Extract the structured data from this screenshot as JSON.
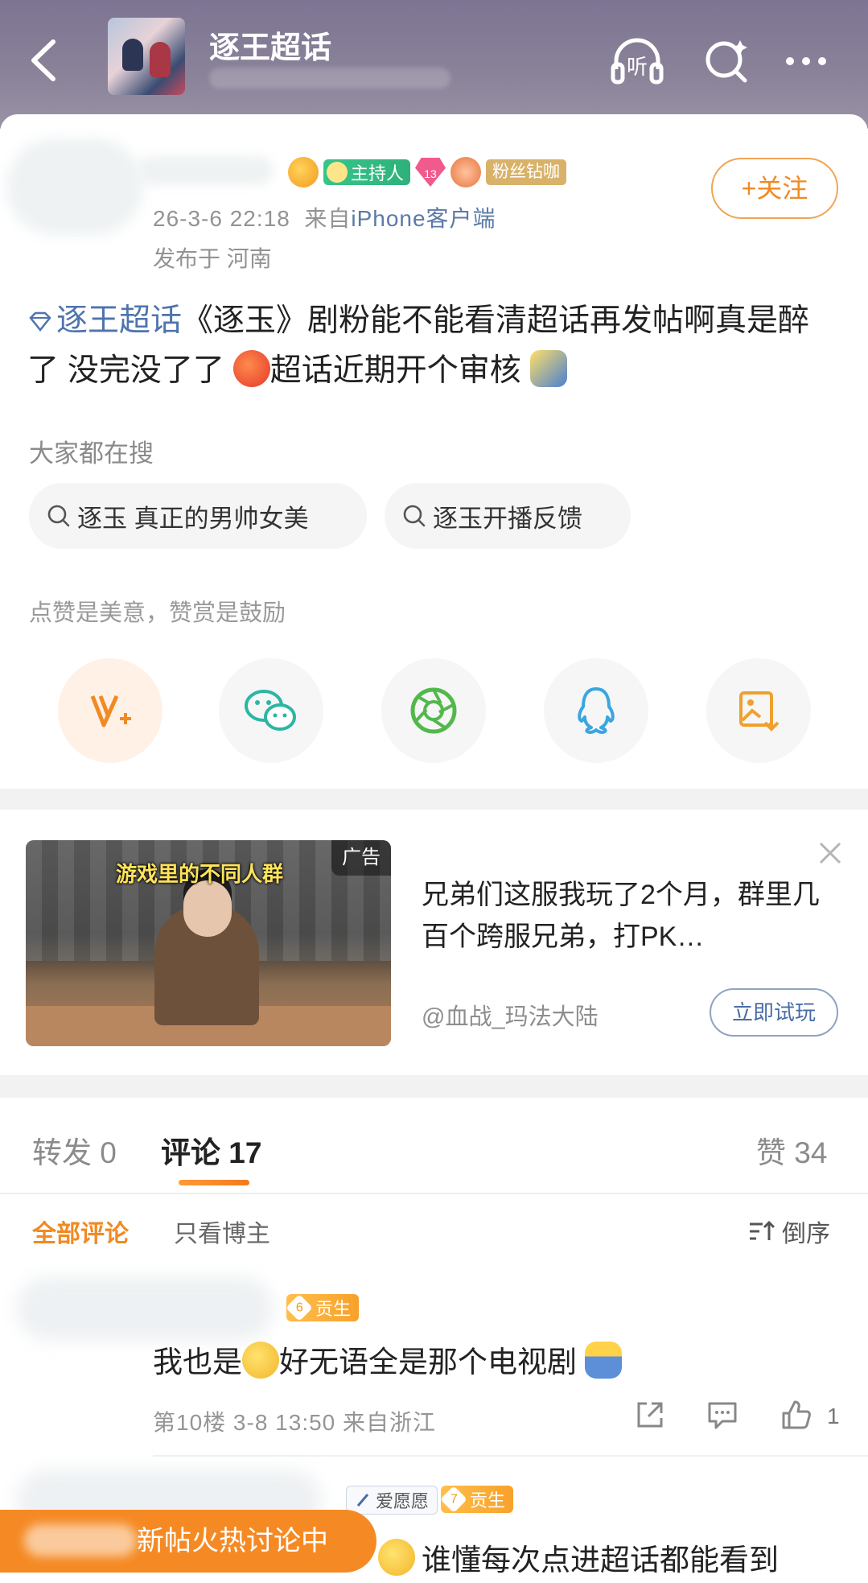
{
  "header": {
    "title": "逐王超话",
    "listen_label": "听"
  },
  "post": {
    "badges": {
      "host": "主持人",
      "gem_level": "13",
      "fans": "粉丝钻咖"
    },
    "time": "26-3-6 22:18",
    "from_prefix": "来自",
    "source": "iPhone客户端",
    "location": "发布于 河南",
    "follow_label": "+关注",
    "topic": "逐王超话",
    "text_a": "《逐玉》剧粉能不能看清超话再发帖啊真是醉了 没完没了了",
    "text_b": "超话近期开个审核",
    "search_label": "大家都在搜",
    "chips": [
      "逐玉 真正的男帅女美",
      "逐玉开播反馈"
    ],
    "reward_label": "点赞是美意，赞赏是鼓励"
  },
  "ad": {
    "caption": "游戏里的不同人群",
    "tag": "广告",
    "text": "兄弟们这服我玩了2个月，群里几百个跨服兄弟，打PK…",
    "source": "@血战_玛法大陆",
    "cta": "立即试玩"
  },
  "comments": {
    "tabs": {
      "repost": "转发 0",
      "comment": "评论 17",
      "like": "赞 34"
    },
    "filter_all": "全部评论",
    "filter_op": "只看博主",
    "sort_label": "倒序",
    "c1": {
      "level": "6",
      "badge": "贡生",
      "text_a": "我也是",
      "text_b": "好无语全是那个电视剧",
      "meta": "第10楼 3-8 13:50 来自浙江",
      "like_count": "1"
    },
    "c2": {
      "love_badge": "爱愿愿",
      "level": "7",
      "badge": "贡生",
      "text": "谁懂每次点进超话都能看到"
    },
    "hot_pill": "新帖火热讨论中"
  }
}
